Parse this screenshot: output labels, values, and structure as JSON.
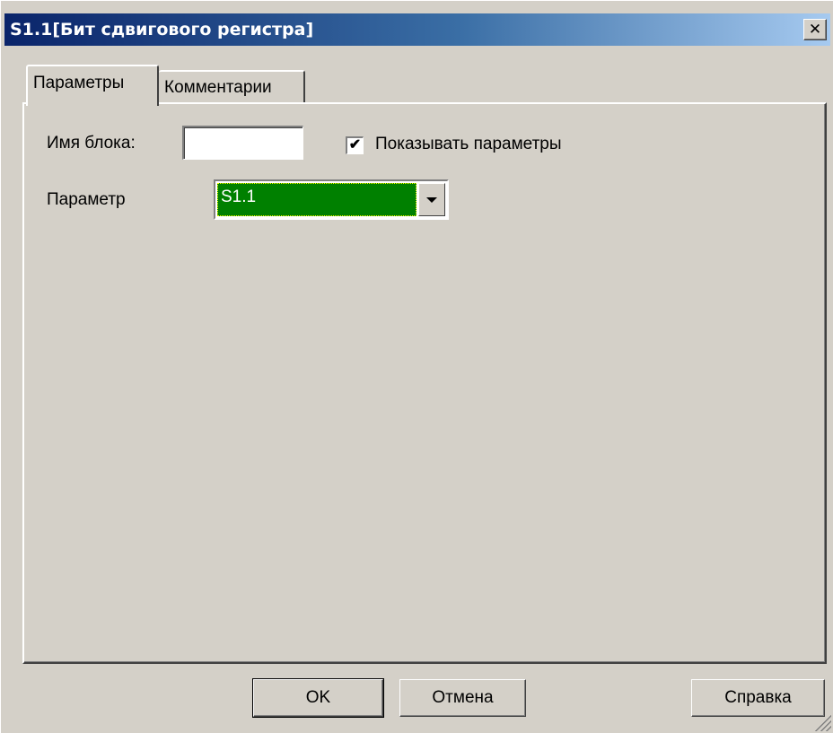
{
  "window": {
    "title": "S1.1[Бит сдвигового регистра]",
    "close_glyph": "✕"
  },
  "tabs": [
    {
      "label": "Параметры",
      "active": true
    },
    {
      "label": "Комментарии",
      "active": false
    }
  ],
  "form": {
    "block_name_label": "Имя блока:",
    "block_name_value": "",
    "show_params_label": "Показывать параметры",
    "show_params_checked": true,
    "parameter_label": "Параметр",
    "parameter_value": "S1.1",
    "parameter_highlight_color": "#008000"
  },
  "buttons": {
    "ok": "OK",
    "cancel": "Отмена",
    "help": "Справка"
  },
  "colors": {
    "title_start": "#0a246a",
    "title_end": "#a6caf0",
    "face": "#d4d0c8"
  }
}
